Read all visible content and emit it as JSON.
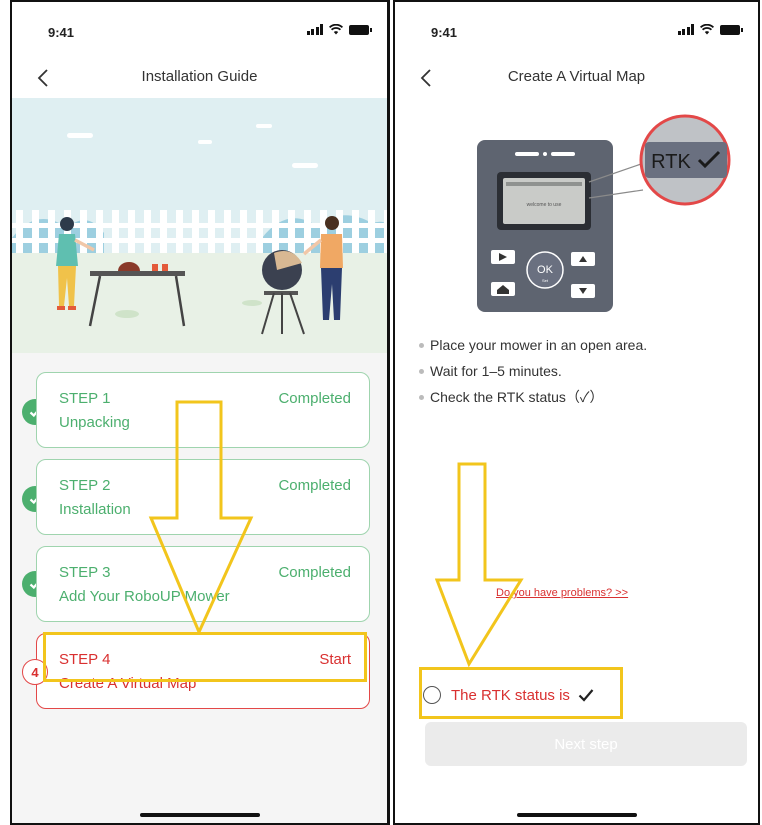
{
  "left_screen": {
    "status": {
      "time": "9:41"
    },
    "nav": {
      "title": "Installation Guide"
    },
    "steps": [
      {
        "label": "STEP 1",
        "status": "Completed",
        "description": "Unpacking"
      },
      {
        "label": "STEP 2",
        "status": "Completed",
        "description": "Installation"
      },
      {
        "label": "STEP 3",
        "status": "Completed",
        "description": "Add Your RoboUP Mower"
      },
      {
        "label": "STEP 4",
        "status": "Start",
        "description": "Create A Virtual Map",
        "badge": "4"
      }
    ]
  },
  "right_screen": {
    "status": {
      "time": "9:41"
    },
    "nav": {
      "title": "Create A Virtual Map"
    },
    "device": {
      "rtk_badge": "RTK",
      "screen_text": "welcome to use",
      "ok_label": "OK",
      "ok_sub": "Set"
    },
    "instructions": [
      "Place your mower in an open area.",
      "Wait for 1–5 minutes.",
      "Check the RTK status（✓）"
    ],
    "problems_link": "Do you have problems?  >>",
    "rtk_status_label": "The RTK status is",
    "next_button": "Next step"
  },
  "colors": {
    "success_green": "#4caf6e",
    "accent_red": "#d93030",
    "highlight_yellow": "#f2c51c",
    "illustration_bg": "#dfeff2"
  }
}
